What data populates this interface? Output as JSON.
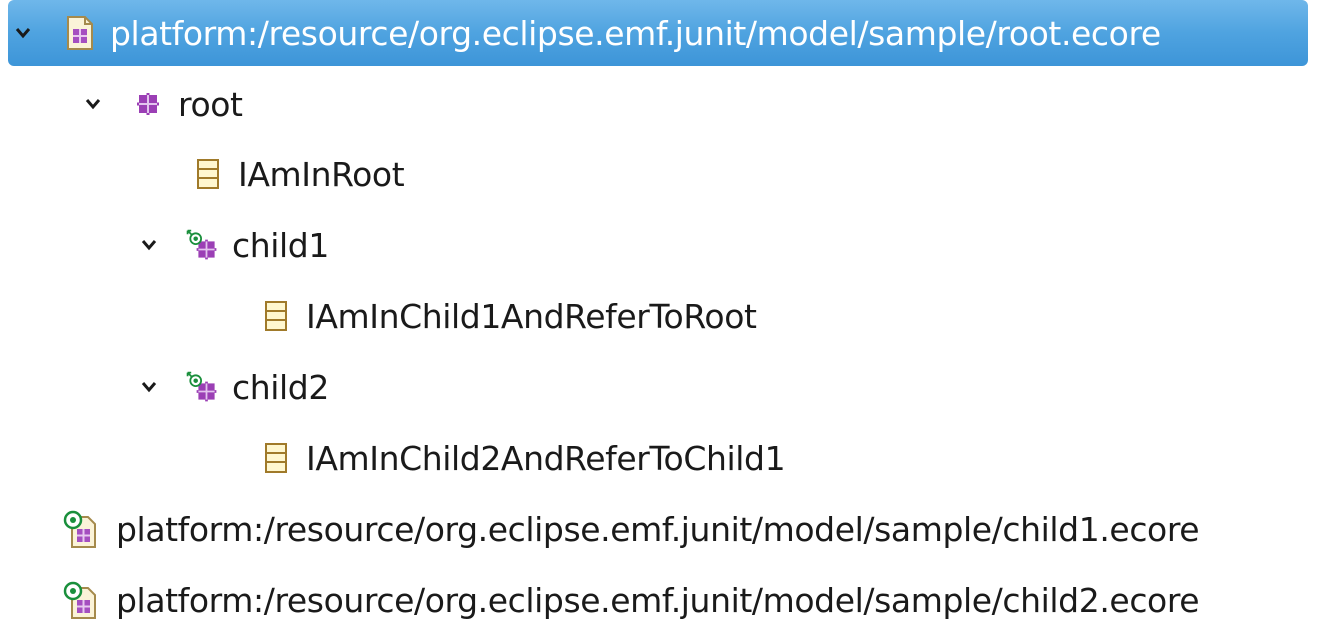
{
  "tree": {
    "items": [
      {
        "label": "platform:/resource/org.eclipse.emf.junit/model/sample/root.ecore",
        "icon": "ecore-resource-icon",
        "expanded": true,
        "selected": true
      },
      {
        "label": "root",
        "icon": "epackage-icon",
        "expanded": true
      },
      {
        "label": "IAmInRoot",
        "icon": "eclass-icon"
      },
      {
        "label": "child1",
        "icon": "referenced-epackage-icon",
        "expanded": true
      },
      {
        "label": "IAmInChild1AndReferToRoot",
        "icon": "eclass-icon"
      },
      {
        "label": "child2",
        "icon": "referenced-epackage-icon",
        "expanded": true
      },
      {
        "label": "IAmInChild2AndReferToChild1",
        "icon": "eclass-icon"
      },
      {
        "label": "platform:/resource/org.eclipse.emf.junit/model/sample/child1.ecore",
        "icon": "linked-ecore-resource-icon"
      },
      {
        "label": "platform:/resource/org.eclipse.emf.junit/model/sample/child2.ecore",
        "icon": "linked-ecore-resource-icon"
      }
    ]
  },
  "colors": {
    "selection": "#4fa3e0",
    "epackage": "#9b3fb5",
    "eclass_fill": "#fff7cf",
    "eclass_border": "#a07a2a",
    "link_green": "#1a8f3c"
  }
}
